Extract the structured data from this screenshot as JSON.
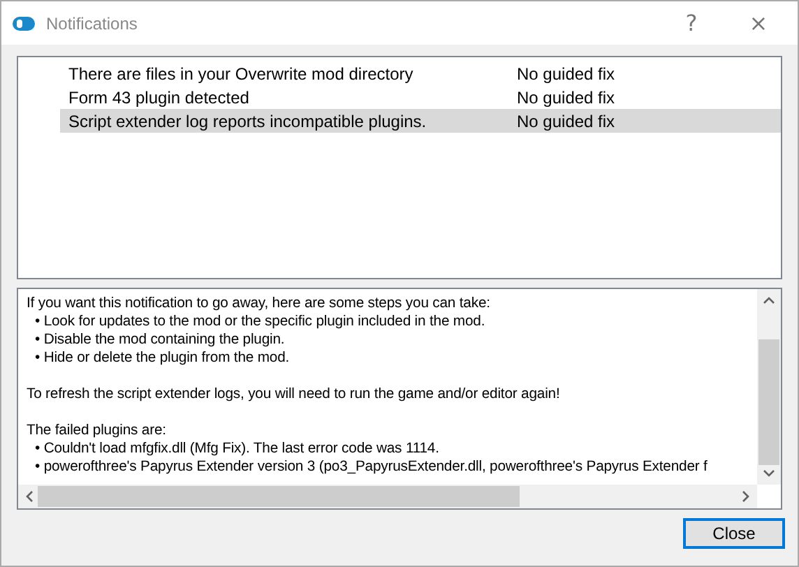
{
  "window": {
    "title": "Notifications",
    "help": "?",
    "close": "×"
  },
  "notifications": [
    {
      "message": "There are files in your Overwrite mod directory",
      "fix": "No guided fix",
      "selected": false
    },
    {
      "message": "Form 43 plugin detected",
      "fix": "No guided fix",
      "selected": false
    },
    {
      "message": "Script extender log reports incompatible plugins.",
      "fix": "No guided fix",
      "selected": true
    }
  ],
  "details": [
    [
      "If you want this notification to go away, here are some steps you can take:",
      "• Look for updates to the mod or the specific plugin included in the mod.",
      "• Disable the mod containing the plugin.",
      "• Hide or delete the plugin from the mod."
    ],
    [
      "To refresh the script extender logs, you will need to run the game and/or editor again!"
    ],
    [
      "The failed plugins are:",
      "• Couldn't load mfgfix.dll (Mfg Fix). The last error code was 1114.",
      "• powerofthree's Papyrus Extender version 3 (po3_PapyrusExtender.dll, powerofthree's Papyrus Extender f"
    ]
  ],
  "buttons": [
    "Close"
  ]
}
